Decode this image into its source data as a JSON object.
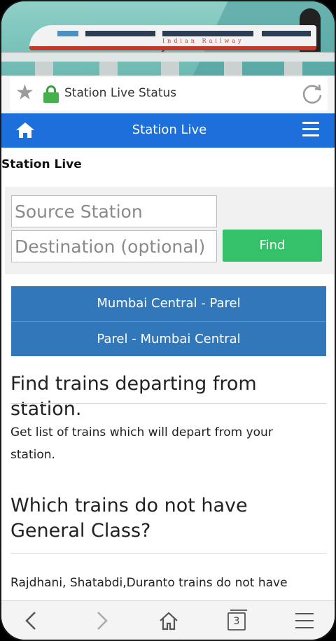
{
  "banner": {
    "train_name": "Indian Railway"
  },
  "address_bar": {
    "title": "Station Live Status"
  },
  "navbar": {
    "title": "Station Live"
  },
  "page": {
    "heading": "Station Live"
  },
  "form": {
    "source_placeholder": "Source Station",
    "destination_placeholder": "Destination (optional)",
    "find_label": "Find"
  },
  "routes": [
    {
      "label": "Mumbai Central - Parel"
    },
    {
      "label": "Parel - Mumbai Central"
    }
  ],
  "articles": [
    {
      "title": "Find trains departing from station.",
      "body": "Get list of trains which will depart from your station."
    },
    {
      "title": "Which trains do not have General Class?",
      "body": "Rajdhani, Shatabdi,Duranto trains do not have"
    }
  ],
  "bottom_bar": {
    "tab_count": "3"
  },
  "colors": {
    "navbar": "#1d6fdc",
    "find_button": "#35c16a",
    "route_button": "#3377bb"
  }
}
